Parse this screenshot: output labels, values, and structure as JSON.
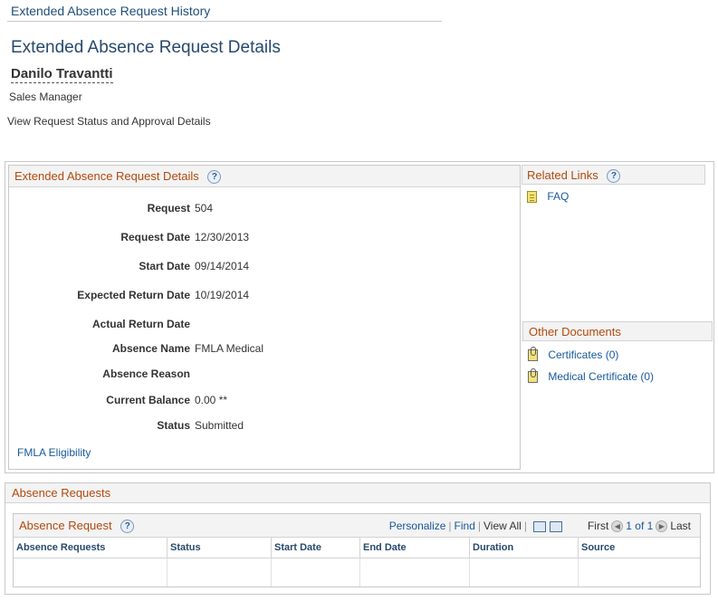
{
  "breadcrumb": {
    "link": "Extended Absence Request History"
  },
  "page": {
    "title": "Extended Absence Request Details"
  },
  "employee": {
    "name": "Danilo Travantti",
    "job_title": "Sales Manager"
  },
  "instruction": "View Request Status and Approval Details",
  "details": {
    "header": "Extended Absence Request Details",
    "fields": [
      {
        "label": "Request",
        "value": "504"
      },
      {
        "label": "Request Date",
        "value": "12/30/2013"
      },
      {
        "label": "Start Date",
        "value": "09/14/2014"
      },
      {
        "label": "Expected Return Date",
        "value": "10/19/2014"
      },
      {
        "label": "Actual Return Date",
        "value": ""
      },
      {
        "label": "Absence Name",
        "value": "FMLA Medical"
      },
      {
        "label": "Absence Reason",
        "value": ""
      },
      {
        "label": "Current Balance",
        "value": "0.00 **"
      },
      {
        "label": "Status",
        "value": "Submitted"
      }
    ],
    "fmla_link": "FMLA Eligibility"
  },
  "help_icon": "?",
  "related_links": {
    "header": "Related Links",
    "items": [
      {
        "label": "FAQ",
        "icon": "document-icon"
      }
    ]
  },
  "other_documents": {
    "header": "Other Documents",
    "items": [
      {
        "label": "Certificates (0)",
        "icon": "paperclip-icon"
      },
      {
        "label": "Medical Certificate (0)",
        "icon": "paperclip-icon"
      }
    ]
  },
  "absence_requests": {
    "section_header": "Absence Requests",
    "grid_title": "Absence Request",
    "nav": {
      "personalize": "Personalize",
      "find": "Find",
      "view_all": "View All",
      "first": "First",
      "page_info": "1 of 1",
      "last": "Last"
    },
    "columns": [
      "Absence Requests",
      "Status",
      "Start Date",
      "End Date",
      "Duration",
      "Source"
    ],
    "rows": []
  },
  "colors": {
    "accent_orange": "#b24a0e",
    "link_blue": "#18589b",
    "title_blue": "#27496d"
  }
}
